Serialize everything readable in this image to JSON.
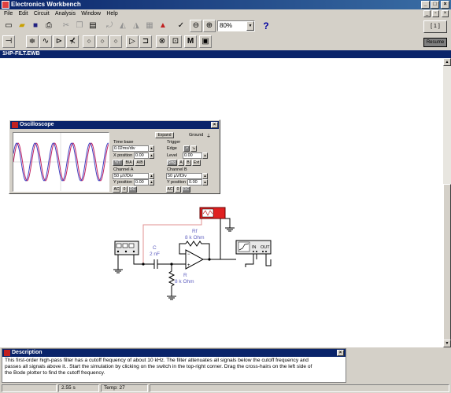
{
  "app": {
    "title": "Electronics Workbench"
  },
  "menu": [
    "File",
    "Edit",
    "Circuit",
    "Analysis",
    "Window",
    "Help"
  ],
  "toolbar": {
    "zoom_value": "80%",
    "help_label": "?",
    "resume_label": "Resume"
  },
  "document": {
    "title": "1HP-FILT.EWB"
  },
  "oscilloscope": {
    "title": "Oscilloscope",
    "expand_label": "Expand",
    "ground_label": "Ground",
    "time_base_label": "Time base",
    "time_base_value": "0.02ms/div",
    "x_position_label": "X position",
    "x_position_value": "0.00",
    "mode_buttons": [
      "Y/T",
      "B/A",
      "A/B"
    ],
    "trigger_label": "Trigger",
    "edge_label": "Edge",
    "level_label": "Level",
    "level_value": "0.00",
    "trigger_buttons": [
      "Sing.",
      "A",
      "B",
      "Ext"
    ],
    "channel_a_label": "Channel A",
    "channel_a_scale": "50 µV/Div",
    "channel_b_label": "Channel B",
    "channel_b_scale": "50 µV/Div",
    "y_position_label": "Y position",
    "y_position_a": "0.00",
    "y_position_b": "0.00",
    "coupling_buttons": [
      "AC",
      "0",
      "DC"
    ]
  },
  "circuit": {
    "capacitor_name": "C",
    "capacitor_value": "2 nF",
    "resistor_f_name": "Rf",
    "resistor_f_value": "8 k Ohm",
    "resistor_name": "R",
    "resistor_value": "8 k Ohm",
    "bode_in": "IN",
    "bode_out": "OUT"
  },
  "description": {
    "title": "Description",
    "lines": [
      "This first-order high-pass filter has a cutoff frequency of about 10 kHz. The filter attenuates all signals below the cutoff frequency and",
      "passes all signals above it.. Start the simulation by clicking on the switch in the top-right corner. Drag the cross-hairs on the left side of",
      "the Bode plotter to find the cutoff frequency."
    ]
  },
  "status": {
    "time": "2.55 s",
    "temp": "Temp: 27"
  }
}
